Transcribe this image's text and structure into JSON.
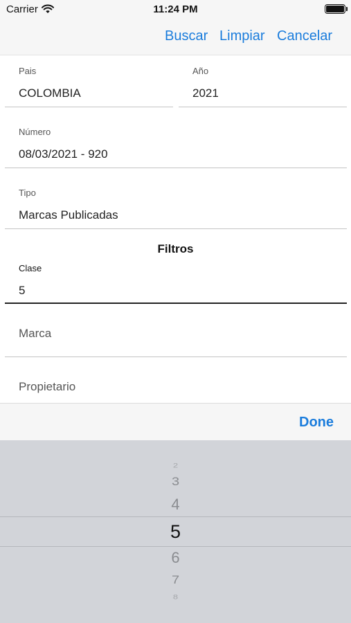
{
  "status_bar": {
    "carrier": "Carrier",
    "time": "11:24 PM"
  },
  "nav": {
    "buscar": "Buscar",
    "limpiar": "Limpiar",
    "cancelar": "Cancelar"
  },
  "form": {
    "pais": {
      "label": "Pais",
      "value": "COLOMBIA"
    },
    "anio": {
      "label": "Año",
      "value": "2021"
    },
    "numero": {
      "label": "Número",
      "value": "08/03/2021 - 920"
    },
    "tipo": {
      "label": "Tipo",
      "value": "Marcas Publicadas"
    }
  },
  "filtros": {
    "title": "Filtros",
    "clase": {
      "label": "Clase",
      "value": "5"
    },
    "marca_placeholder": "Marca",
    "propietario_placeholder": "Propietario"
  },
  "toolbar": {
    "done": "Done"
  },
  "picker": {
    "options": [
      "2",
      "3",
      "4",
      "5",
      "6",
      "7",
      "8"
    ],
    "selected": "5"
  },
  "colors": {
    "accent": "#1a7cdc",
    "picker_bg": "#d2d4d9",
    "bar_bg": "#f6f6f6"
  }
}
